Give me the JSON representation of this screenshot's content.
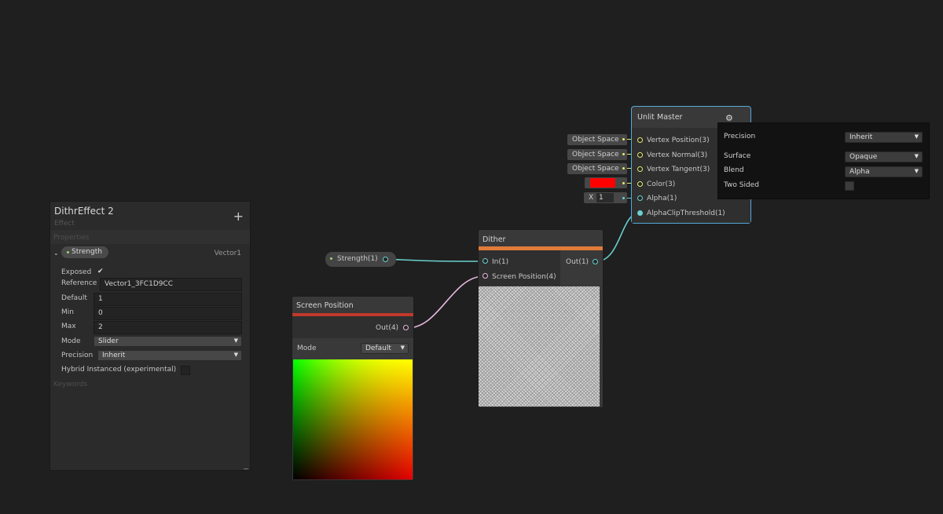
{
  "blackboard": {
    "title": "DithrEffect 2",
    "subtitle": "Effect",
    "add_icon": "+",
    "properties_header": "Properties",
    "keywords_header": "Keywords",
    "property": {
      "name": "Strength",
      "type": "Vector1",
      "exposed_label": "Exposed",
      "exposed_check": "✔",
      "reference_label": "Reference",
      "reference_value": "Vector1_3FC1D9CC",
      "default_label": "Default",
      "default_value": "1",
      "min_label": "Min",
      "min_value": "0",
      "max_label": "Max",
      "max_value": "2",
      "mode_label": "Mode",
      "mode_value": "Slider",
      "precision_label": "Precision",
      "precision_value": "Inherit",
      "hybrid_label": "Hybrid Instanced (experimental)"
    }
  },
  "strength_node": {
    "label": "Strength(1)"
  },
  "screen_position_node": {
    "title": "Screen Position",
    "output": "Out(4)",
    "mode_label": "Mode",
    "mode_value": "Default",
    "header_color": "#c0392b"
  },
  "dither_node": {
    "title": "Dither",
    "input_1": "In(1)",
    "input_2": "Screen Position(4)",
    "output": "Out(1)",
    "header_color": "#e07b39"
  },
  "master_node": {
    "title": "Unlit Master",
    "gear_icon": "gear-icon",
    "ports": [
      "Vertex Position(3)",
      "Vertex Normal(3)",
      "Vertex Tangent(3)",
      "Color(3)",
      "Alpha(1)",
      "AlphaClipThreshold(1)"
    ],
    "space_inputs": [
      "Object Space",
      "Object Space",
      "Object Space"
    ],
    "color_value": "#ff0000",
    "alpha_axis": "X",
    "alpha_value": "1"
  },
  "settings": {
    "precision_label": "Precision",
    "precision_value": "Inherit",
    "surface_label": "Surface",
    "surface_value": "Opaque",
    "blend_label": "Blend",
    "blend_value": "Alpha",
    "two_sided_label": "Two Sided"
  }
}
